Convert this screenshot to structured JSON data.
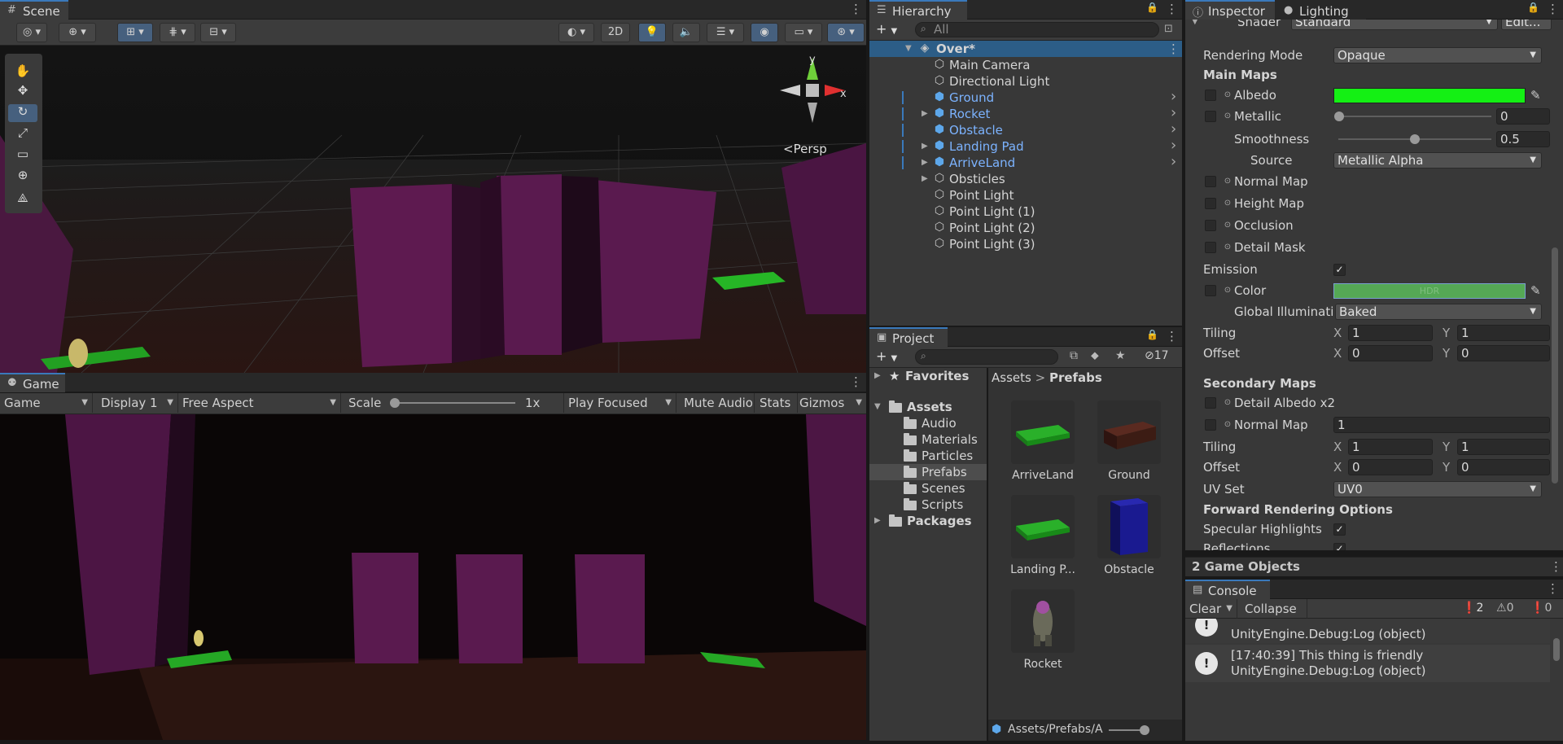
{
  "scene": {
    "tab": "Scene",
    "view_2d": "2D",
    "persp": "Persp",
    "axis_y": "y",
    "axis_x": "x"
  },
  "game": {
    "tab": "Game",
    "view_select": "Game",
    "display": "Display 1",
    "aspect": "Free Aspect",
    "scale_label": "Scale",
    "scale_value": "1x",
    "play_mode": "Play Focused",
    "mute": "Mute Audio",
    "stats": "Stats",
    "gizmos": "Gizmos"
  },
  "hierarchy": {
    "tab": "Hierarchy",
    "search_placeholder": "All",
    "scene_name": "Over*",
    "items": [
      {
        "label": "Main Camera",
        "prefab": false,
        "expand": false
      },
      {
        "label": "Directional Light",
        "prefab": false,
        "expand": false
      },
      {
        "label": "Ground",
        "prefab": true,
        "expand": false
      },
      {
        "label": "Rocket",
        "prefab": true,
        "expand": true
      },
      {
        "label": "Obstacle",
        "prefab": true,
        "expand": false
      },
      {
        "label": "Landing Pad",
        "prefab": true,
        "expand": true
      },
      {
        "label": "ArriveLand",
        "prefab": true,
        "expand": true
      },
      {
        "label": "Obsticles",
        "prefab": false,
        "expand": true
      },
      {
        "label": "Point Light",
        "prefab": false,
        "expand": false
      },
      {
        "label": "Point Light (1)",
        "prefab": false,
        "expand": false
      },
      {
        "label": "Point Light (2)",
        "prefab": false,
        "expand": false
      },
      {
        "label": "Point Light (3)",
        "prefab": false,
        "expand": false
      }
    ]
  },
  "project": {
    "tab": "Project",
    "hidden_count": "17",
    "favorites": "Favorites",
    "assets": "Assets",
    "folders": [
      "Audio",
      "Materials",
      "Particles",
      "Prefabs",
      "Scenes",
      "Scripts"
    ],
    "packages": "Packages",
    "breadcrumb_root": "Assets",
    "breadcrumb_current": "Prefabs",
    "tiles": [
      {
        "label": "ArriveLand",
        "kind": "green-pad"
      },
      {
        "label": "Ground",
        "kind": "brown-box"
      },
      {
        "label": "Landing P...",
        "kind": "green-pad"
      },
      {
        "label": "Obstacle",
        "kind": "blue-box"
      },
      {
        "label": "Rocket",
        "kind": "rocket"
      }
    ],
    "footer_path": "Assets/Prefabs/A"
  },
  "inspector": {
    "tab": "Inspector",
    "lighting_tab": "Lighting",
    "shader_label": "Shader",
    "shader_value": "Standard",
    "edit_button": "Edit...",
    "rendering_mode_label": "Rendering Mode",
    "rendering_mode": "Opaque",
    "main_maps": "Main Maps",
    "albedo": "Albedo",
    "albedo_color": "#14f014",
    "metallic": "Metallic",
    "metallic_value": "0",
    "smoothness": "Smoothness",
    "smoothness_value": "0.5",
    "source": "Source",
    "source_value": "Metallic Alpha",
    "normal_map": "Normal Map",
    "height_map": "Height Map",
    "occlusion": "Occlusion",
    "detail_mask": "Detail Mask",
    "emission": "Emission",
    "color": "Color",
    "hdr": "HDR",
    "emission_color": "#55a855",
    "gi_label": "Global Illuminatic",
    "gi_value": "Baked",
    "tiling": "Tiling",
    "offset": "Offset",
    "x": "X",
    "y": "Y",
    "tiling_x": "1",
    "tiling_y": "1",
    "offset_x": "0",
    "offset_y": "0",
    "secondary_maps": "Secondary Maps",
    "detail_albedo": "Detail Albedo x2",
    "normal_map_2": "Normal Map",
    "normal_map_2_value": "1",
    "tiling2_x": "1",
    "tiling2_y": "1",
    "offset2_x": "0",
    "offset2_y": "0",
    "uv_set": "UV Set",
    "uv_set_value": "UV0",
    "forward_options": "Forward Rendering Options",
    "specular": "Specular Highlights",
    "reflections": "Reflections",
    "footer": "2 Game Objects"
  },
  "console": {
    "tab": "Console",
    "clear": "Clear",
    "collapse": "Collapse",
    "info_count": "2",
    "warn_count": "0",
    "error_count": "0",
    "entries": [
      {
        "line1": "",
        "line2": "UnityEngine.Debug:Log (object)"
      },
      {
        "line1": "[17:40:39] This thing is friendly",
        "line2": "UnityEngine.Debug:Log (object)"
      }
    ]
  }
}
